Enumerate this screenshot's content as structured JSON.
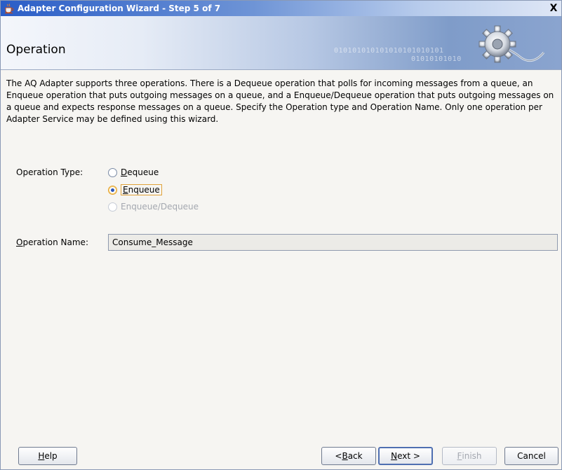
{
  "window": {
    "title": "Adapter Configuration Wizard - Step 5 of 7",
    "close_glyph": "X"
  },
  "banner": {
    "title": "Operation",
    "binary_line1": "010101010101010101010101",
    "binary_line2": "01010101010"
  },
  "description": "The AQ Adapter supports three operations.  There is a Dequeue operation that polls for incoming messages from a queue, an Enqueue operation that puts outgoing messages on a queue, and a Enqueue/Dequeue operation that puts outgoing messages on a queue and expects response messages on a queue.  Specify the Operation type and Operation Name. Only one operation per Adapter Service may be defined using this wizard.",
  "operation_type": {
    "label": "Operation Type:",
    "options": [
      {
        "mnemonic": "D",
        "rest": "equeue",
        "checked": false,
        "enabled": true
      },
      {
        "mnemonic": "E",
        "rest": "nqueue",
        "checked": true,
        "enabled": true
      },
      {
        "mnemonic": "",
        "rest": "Enqueue/Dequeue",
        "checked": false,
        "enabled": false
      }
    ]
  },
  "operation_name": {
    "label_mnemonic": "O",
    "label_rest": "peration Name:",
    "value": "Consume_Message"
  },
  "buttons": {
    "help_mnemonic": "H",
    "help_rest": "elp",
    "back_prefix": "< ",
    "back_mnemonic": "B",
    "back_rest": "ack",
    "next_mnemonic": "N",
    "next_rest": "ext >",
    "finish_mnemonic": "F",
    "finish_rest": "inish",
    "cancel": "Cancel"
  },
  "icons": {
    "app": "coffee-cup-icon",
    "banner": "gear-plug-icon"
  },
  "colors": {
    "title_bar": "#2a5dc7",
    "focus_outline": "#e0a23a",
    "radio_dot": "#2b55b8"
  }
}
